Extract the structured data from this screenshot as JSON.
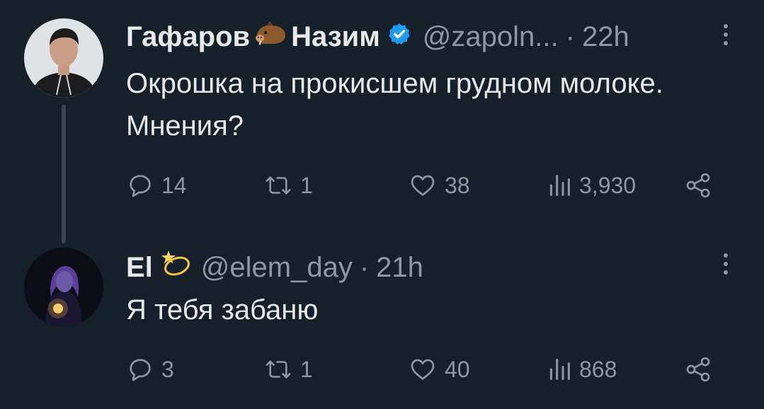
{
  "tweets": [
    {
      "name_first": "Гафаров",
      "name_emoji": "boar",
      "name_last": "Назим",
      "verified": true,
      "handle": "@zapoln...",
      "separator": "·",
      "time": "22h",
      "text": "Окрошка на прокисшем грудном молоке. Мнения?",
      "replies": "14",
      "retweets": "1",
      "likes": "38",
      "views": "3,930"
    },
    {
      "name_first": "El",
      "name_emoji": "dizzy",
      "handle": "@elem_day",
      "separator": "·",
      "time": "21h",
      "text": "Я тебя забаню",
      "replies": "3",
      "retweets": "1",
      "likes": "40",
      "views": "868"
    }
  ],
  "colors": {
    "background": "#15202b",
    "text": "#e7e9ea",
    "muted": "#8b98a5",
    "verified": "#1d9bf0"
  }
}
